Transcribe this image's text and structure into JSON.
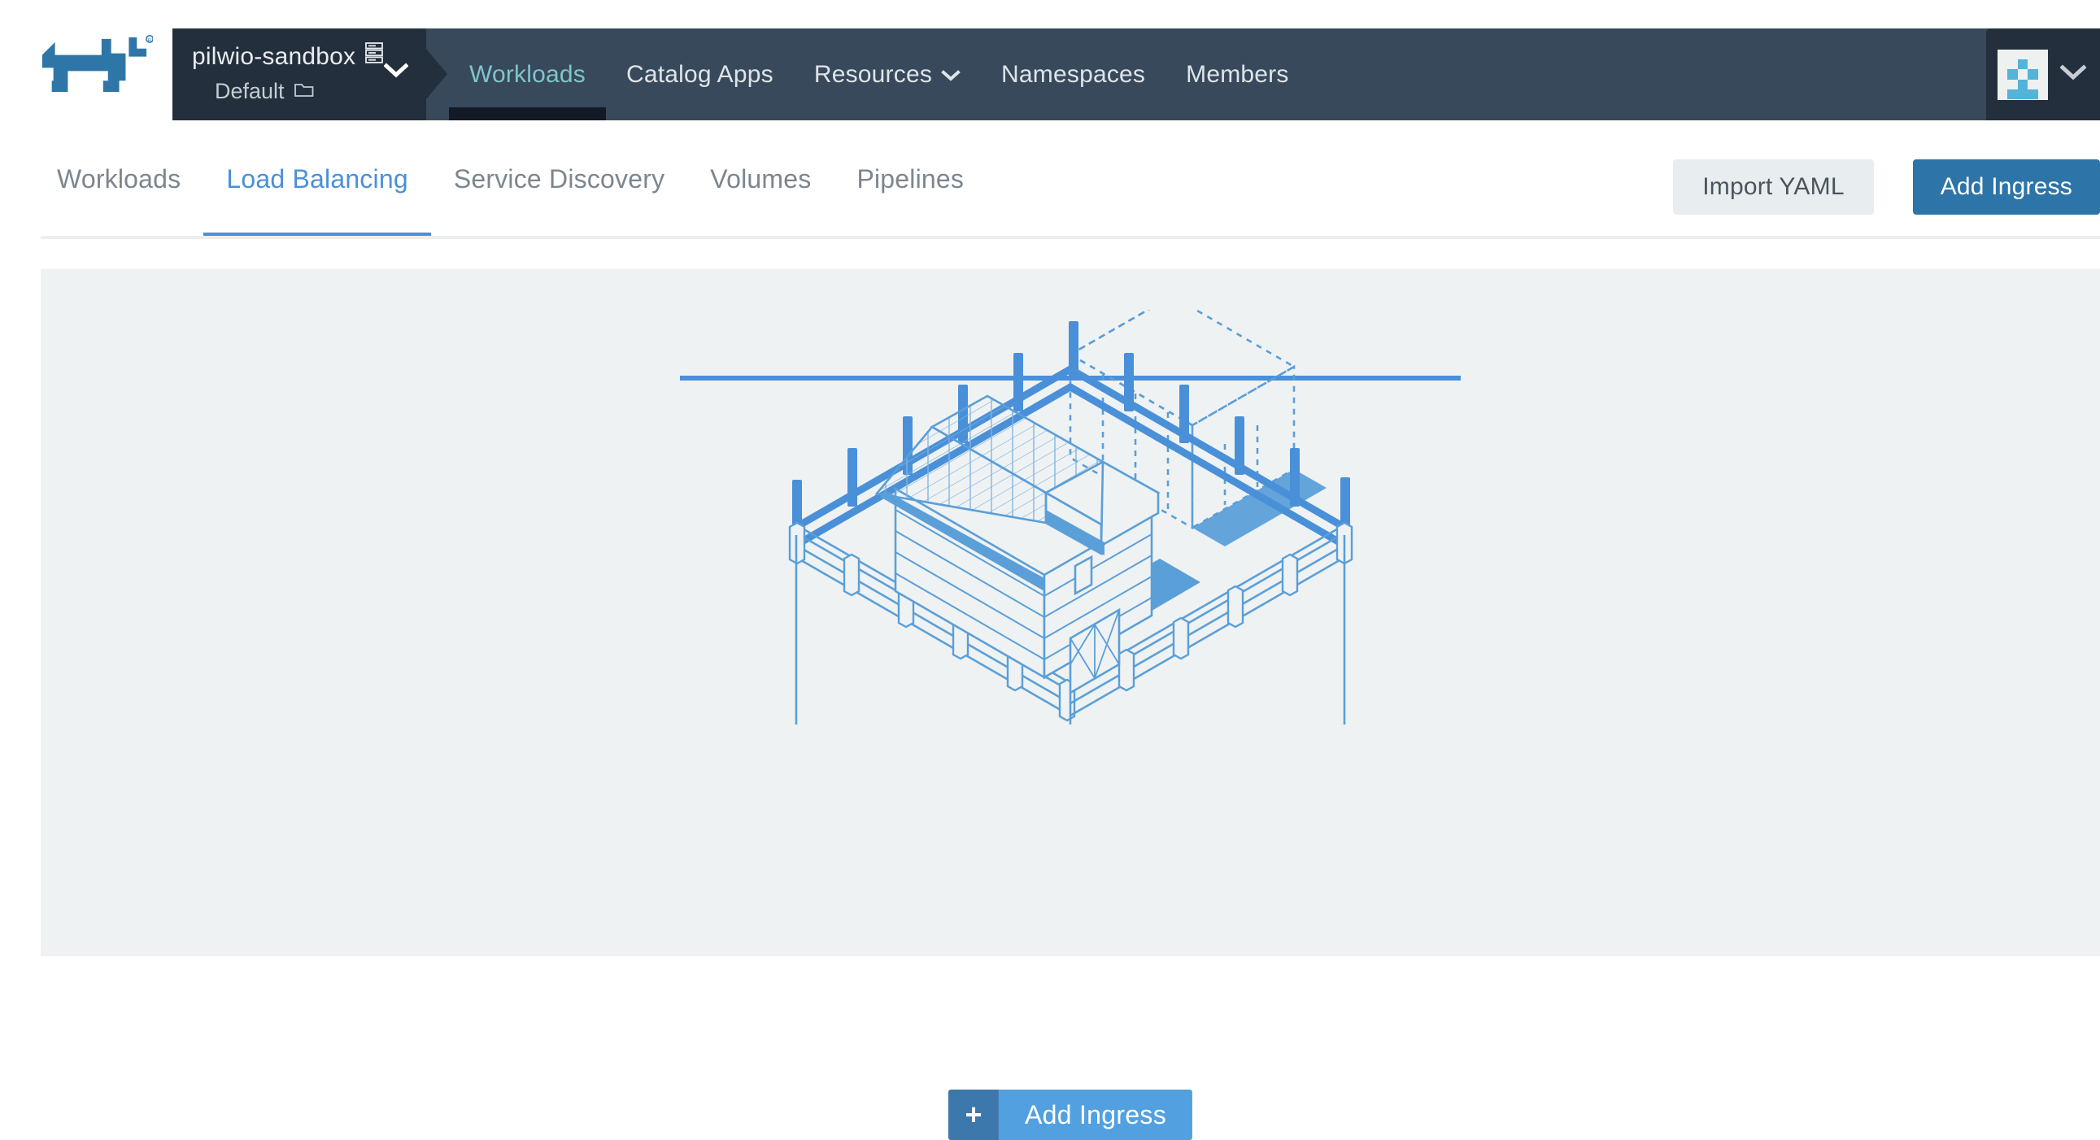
{
  "brand": {
    "logo_name": "rancher-cow-logo",
    "logo_color": "#2f76a8",
    "trademark": "®"
  },
  "topnav": {
    "cluster": {
      "name": "pilwio-sandbox",
      "name_icon": "server-stack-icon",
      "project": "Default",
      "project_icon": "folder-icon",
      "chevron_icon": "chevron-down-icon"
    },
    "items": [
      {
        "label": "Workloads",
        "icon": null,
        "active": true
      },
      {
        "label": "Catalog Apps",
        "icon": null,
        "active": false
      },
      {
        "label": "Resources",
        "icon": "chevron-down-icon",
        "active": false
      },
      {
        "label": "Namespaces",
        "icon": null,
        "active": false
      },
      {
        "label": "Members",
        "icon": null,
        "active": false
      }
    ],
    "user": {
      "avatar_name": "user-identicon-avatar",
      "avatar_color": "#53b4d9",
      "chevron_icon": "chevron-down-icon"
    },
    "colors": {
      "nav_bg": "#37495b",
      "cluster_bg": "#232f3c",
      "active_text": "#7fc5c9",
      "active_underline": "#141a25"
    }
  },
  "subnav": {
    "tabs": [
      {
        "label": "Workloads",
        "active": false
      },
      {
        "label": "Load Balancing",
        "active": true
      },
      {
        "label": "Service Discovery",
        "active": false
      },
      {
        "label": "Volumes",
        "active": false
      },
      {
        "label": "Pipelines",
        "active": false
      }
    ],
    "import_yaml_label": "Import YAML",
    "add_ingress_label": "Add Ingress",
    "accent_color": "#4a90d9"
  },
  "main": {
    "panel_bg": "#eff2f3",
    "illustration_name": "empty-state-barn-illustration",
    "illustration_color": "#5b9fd8",
    "cta": {
      "icon": "plus-icon",
      "label": "Add Ingress",
      "icon_bg": "#3c78ab",
      "label_bg": "#53a0e0"
    }
  }
}
